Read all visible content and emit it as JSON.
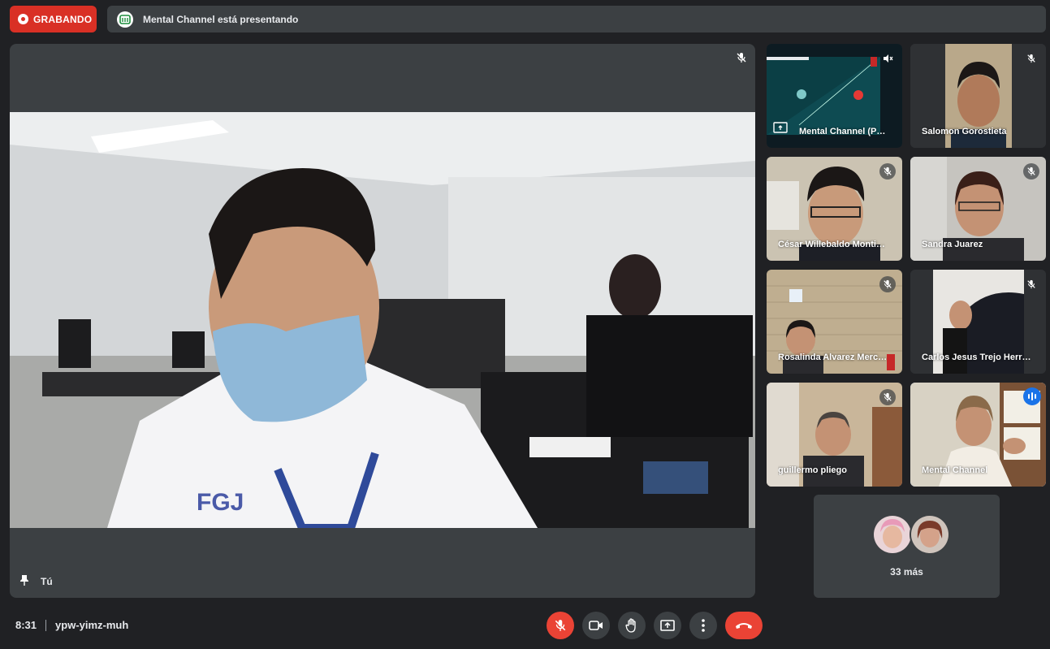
{
  "recording": {
    "label": "GRABANDO",
    "color": "#d93025"
  },
  "presenting_bar": {
    "text": "Mental Channel está presentando"
  },
  "main_speaker": {
    "name": "Tú",
    "mic": "mic-off-icon"
  },
  "participants": [
    {
      "name": "Mental Channel (P…",
      "mic": "volume-off-icon",
      "presentation": true
    },
    {
      "name": "Salomon Gorostieta",
      "mic": "mic-off-icon"
    },
    {
      "name": "César Willebaldo Monti…",
      "mic": "mic-off-icon"
    },
    {
      "name": "Sandra Juarez",
      "mic": "mic-off-icon"
    },
    {
      "name": "Rosalinda Alvarez Merc…",
      "mic": "mic-off-icon"
    },
    {
      "name": "Carlos Jesus Trejo Herr…",
      "mic": "mic-off-icon"
    },
    {
      "name": "guillermo pliego",
      "mic": "mic-off-icon"
    },
    {
      "name": "Mental Channel",
      "mic": "speaking-icon",
      "active": true
    }
  ],
  "more": {
    "label": "33 más"
  },
  "meeting": {
    "time": "8:31",
    "code": "ypw-yimz-muh"
  },
  "controls": [
    "mic-off-icon",
    "camera-icon",
    "raise-hand-icon",
    "present-screen-icon",
    "more-options-icon",
    "end-call-icon"
  ],
  "colors": {
    "background": "#202124",
    "tile": "#3c4043",
    "accent": "#1a73e8",
    "danger": "#ea4335"
  }
}
